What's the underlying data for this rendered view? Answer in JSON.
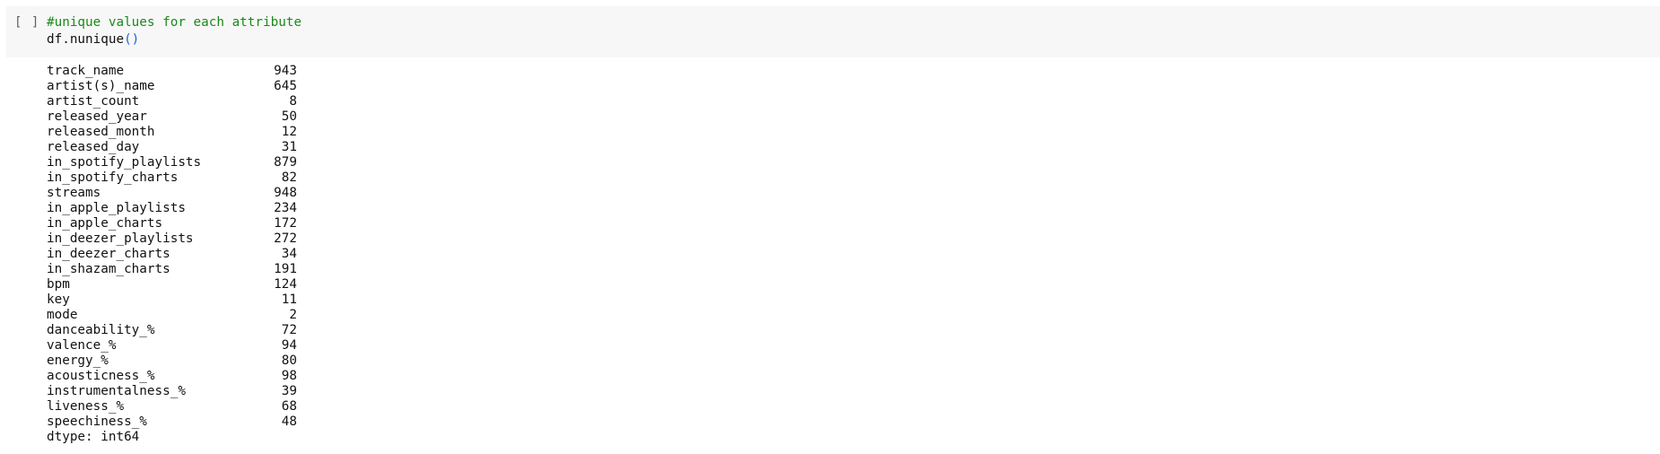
{
  "cell": {
    "run_indicator": "[ ]",
    "code": {
      "comment": "#unique values for each attribute",
      "statement_object": "df.nunique",
      "statement_parens": "()"
    },
    "output": {
      "rows": [
        {
          "name": "track_name",
          "value": "943"
        },
        {
          "name": "artist(s)_name",
          "value": "645"
        },
        {
          "name": "artist_count",
          "value": "8"
        },
        {
          "name": "released_year",
          "value": "50"
        },
        {
          "name": "released_month",
          "value": "12"
        },
        {
          "name": "released_day",
          "value": "31"
        },
        {
          "name": "in_spotify_playlists",
          "value": "879"
        },
        {
          "name": "in_spotify_charts",
          "value": "82"
        },
        {
          "name": "streams",
          "value": "948"
        },
        {
          "name": "in_apple_playlists",
          "value": "234"
        },
        {
          "name": "in_apple_charts",
          "value": "172"
        },
        {
          "name": "in_deezer_playlists",
          "value": "272"
        },
        {
          "name": "in_deezer_charts",
          "value": "34"
        },
        {
          "name": "in_shazam_charts",
          "value": "191"
        },
        {
          "name": "bpm",
          "value": "124"
        },
        {
          "name": "key",
          "value": "11"
        },
        {
          "name": "mode",
          "value": "2"
        },
        {
          "name": "danceability_%",
          "value": "72"
        },
        {
          "name": "valence_%",
          "value": "94"
        },
        {
          "name": "energy_%",
          "value": "80"
        },
        {
          "name": "acousticness_%",
          "value": "98"
        },
        {
          "name": "instrumentalness_%",
          "value": "39"
        },
        {
          "name": "liveness_%",
          "value": "68"
        },
        {
          "name": "speechiness_%",
          "value": "48"
        }
      ],
      "dtype": "dtype: int64"
    }
  },
  "colors": {
    "comment": "#1a8a1a",
    "paren": "#2a5fd6",
    "code_background": "#f7f7f7"
  }
}
